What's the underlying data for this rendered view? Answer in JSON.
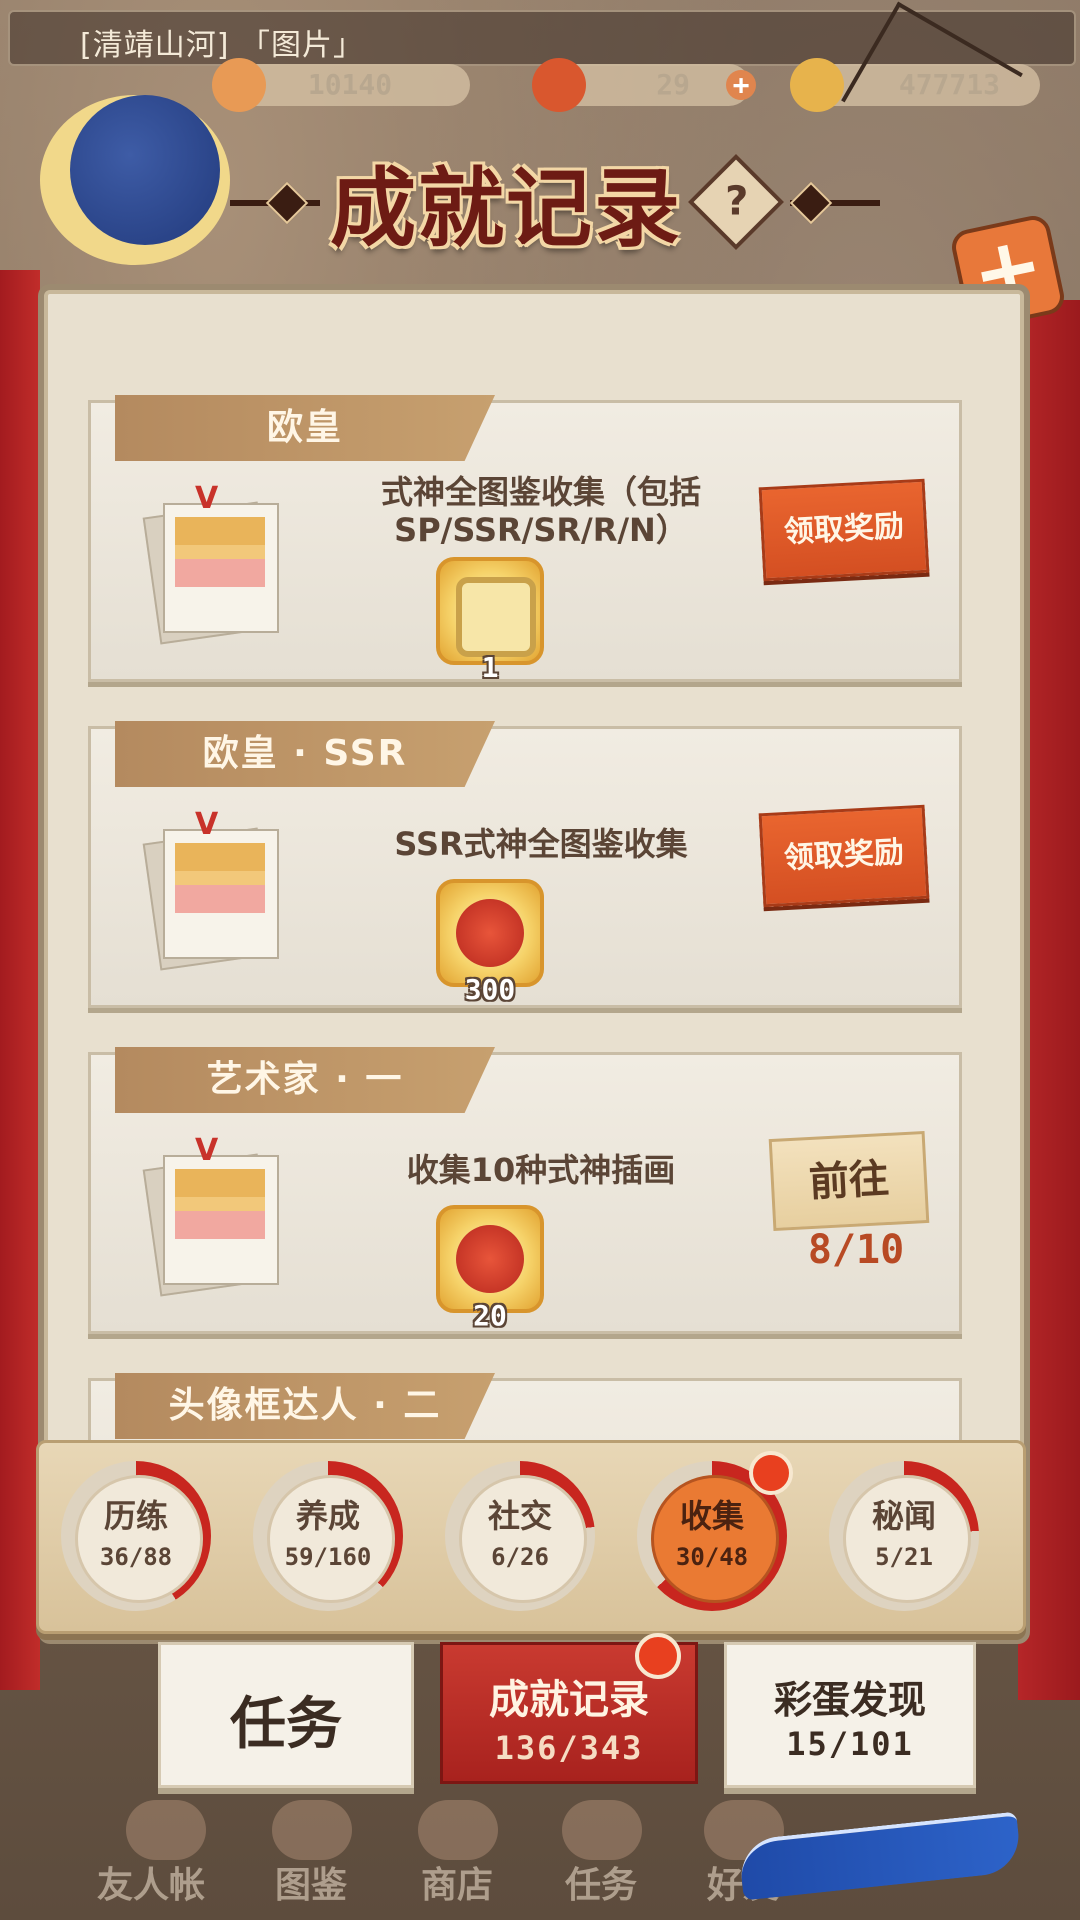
{
  "top_bar": {
    "title": "[清靖山河] 「图片」",
    "resources": [
      {
        "name": "coin-icon",
        "value": "10140",
        "color": "#e89a55"
      },
      {
        "name": "magatama-icon",
        "value": "29",
        "color": "#d9572e"
      },
      {
        "name": "gold-icon",
        "value": "477713",
        "color": "#e7b34c"
      }
    ]
  },
  "header": {
    "title": "成就记录",
    "help_label": "?",
    "close_label": "+"
  },
  "achievements": [
    {
      "tag": "欧皇",
      "description": "式神全图鉴收集（包括SP/SSR/SR/R/N）",
      "reward_icon": "avatar-frame-icon",
      "reward_count": "1",
      "action": "领取奖励",
      "action_type": "claim"
    },
    {
      "tag": "欧皇 · SSR",
      "description": "SSR式神全图鉴收集",
      "reward_icon": "magatama-icon",
      "reward_count": "300",
      "action": "领取奖励",
      "action_type": "claim"
    },
    {
      "tag": "艺术家 · 一",
      "description": "收集10种式神插画",
      "reward_icon": "magatama-icon",
      "reward_count": "20",
      "action": "前往",
      "action_type": "go",
      "progress": "8/10"
    },
    {
      "tag": "头像框达人 · 二"
    }
  ],
  "categories": [
    {
      "name": "历练",
      "progress": "36/88",
      "fraction": 0.41,
      "active": false
    },
    {
      "name": "养成",
      "progress": "59/160",
      "fraction": 0.37,
      "active": false
    },
    {
      "name": "社交",
      "progress": "6/26",
      "fraction": 0.23,
      "active": false
    },
    {
      "name": "收集",
      "progress": "30/48",
      "fraction": 0.63,
      "active": true
    },
    {
      "name": "秘闻",
      "progress": "5/21",
      "fraction": 0.24,
      "active": false
    }
  ],
  "tabs": {
    "task": "任务",
    "achievement": {
      "label": "成就记录",
      "progress": "136/343"
    },
    "easter_egg": {
      "label": "彩蛋发现",
      "progress": "15/101"
    }
  },
  "bottom_nav": [
    "友人帐",
    "图鉴",
    "商店",
    "任务",
    "好友"
  ],
  "colors": {
    "accent_red": "#c93a30",
    "claim_orange": "#e9652f",
    "progress_red": "#c8261f"
  }
}
